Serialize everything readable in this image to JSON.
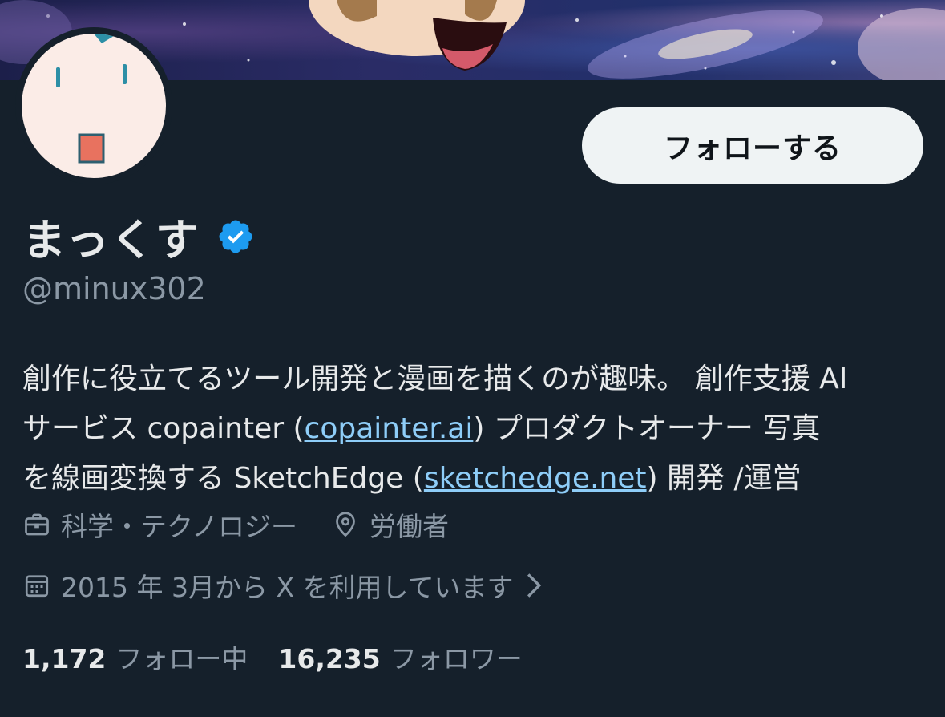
{
  "profile": {
    "display_name": "まっくす",
    "handle": "@minux302",
    "follow_button_label": "フォローする",
    "bio": {
      "line1": "創作に役立てるツール開発と漫画を描くのが趣味。 創作支援 AI",
      "line2_pre": "サービス copainter (",
      "link1": "copainter.ai",
      "line2_post": ") プロダクトオーナー 写真",
      "line3_pre": "を線画変換する SketchEdge (",
      "link2": "sketchedge.net",
      "line3_post": ") 開発 /運営"
    },
    "category": "科学・テクノロジー",
    "location": "労働者",
    "joined": "2015 年 3月から X を利用しています",
    "following_count": "1,172",
    "following_label": "フォロー中",
    "followers_count": "16,235",
    "followers_label": "フォロワー"
  },
  "icons": {
    "verified": "verified-badge-icon",
    "category": "briefcase-icon",
    "location": "location-pin-icon",
    "joined": "calendar-icon",
    "chevron": "chevron-right-icon"
  },
  "colors": {
    "background": "#15202b",
    "link": "#8ecdf8",
    "verified": "#1d9bf0",
    "muted": "#8b98a5"
  }
}
